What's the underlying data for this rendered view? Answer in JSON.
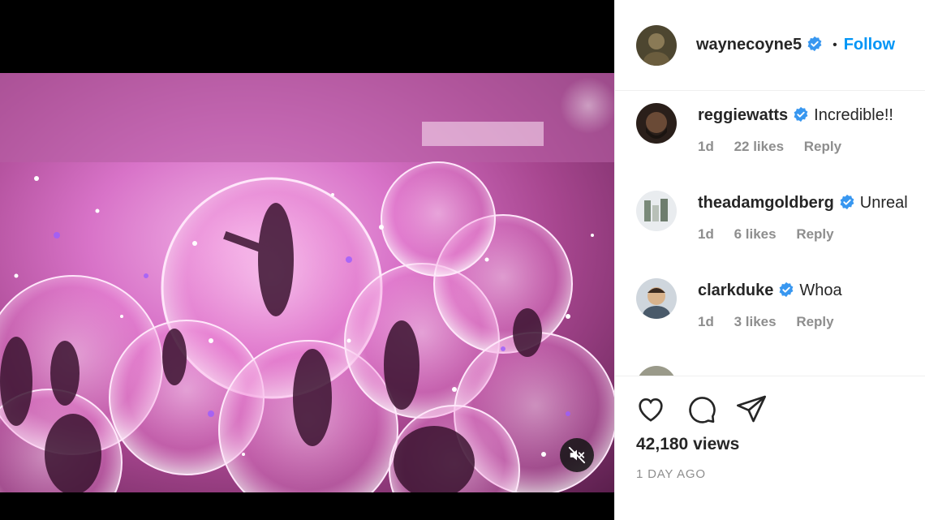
{
  "post": {
    "author": "waynecoyne5",
    "follow_label": "Follow",
    "separator": "•"
  },
  "comments": [
    {
      "user": "reggiewatts",
      "text": "Incredible!!",
      "age": "1d",
      "likes": "22 likes",
      "reply": "Reply"
    },
    {
      "user": "theadamgoldberg",
      "text": "Unreal",
      "age": "1d",
      "likes": "6 likes",
      "reply": "Reply"
    },
    {
      "user": "clarkduke",
      "text": "Whoa",
      "age": "1d",
      "likes": "3 likes",
      "reply": "Reply"
    }
  ],
  "stats": {
    "views": "42,180 views",
    "posted": "1 DAY AGO"
  },
  "icons": {
    "like": "heart-icon",
    "comment": "comment-icon",
    "share": "share-icon",
    "mute": "muted-speaker-icon",
    "verified": "verified-badge-icon"
  },
  "colors": {
    "accent": "#0095f6",
    "muted_text": "#8e8e8e",
    "verified": "#3897f0"
  }
}
